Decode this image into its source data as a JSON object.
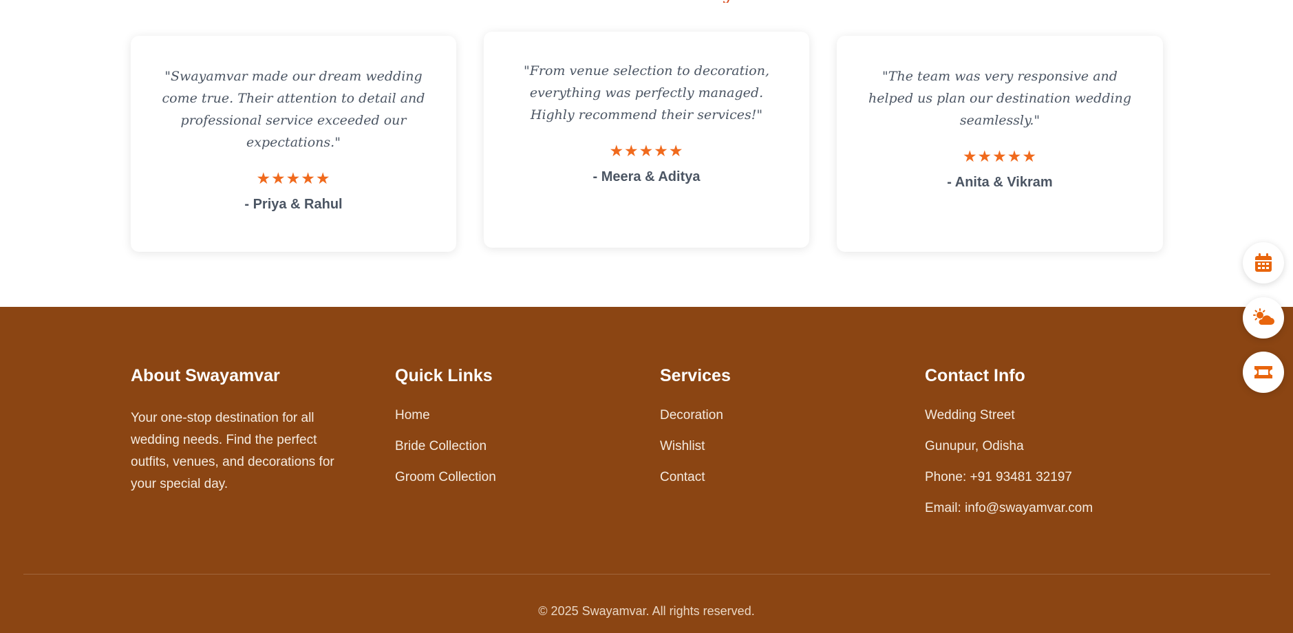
{
  "testimonials": {
    "items": [
      {
        "quote": "\"Swayamvar made our dream wedding come true. Their attention to detail and professional service exceeded our expectations.\"",
        "rating": "★★★★★",
        "author": "- Priya & Rahul"
      },
      {
        "quote": "\"From venue selection to decoration, everything was perfectly managed. Highly recommend their services!\"",
        "rating": "★★★★★",
        "author": "- Meera & Aditya"
      },
      {
        "quote": "\"The team was very responsive and helped us plan our destination wedding seamlessly.\"",
        "rating": "★★★★★",
        "author": "- Anita & Vikram"
      }
    ]
  },
  "footer": {
    "about": {
      "heading": "About Swayamvar",
      "text": "Your one-stop destination for all wedding needs. Find the perfect outfits, venues, and decorations for your special day."
    },
    "quick_links": {
      "heading": "Quick Links",
      "items": [
        "Home",
        "Bride Collection",
        "Groom Collection"
      ]
    },
    "services": {
      "heading": "Services",
      "items": [
        "Decoration",
        "Wishlist",
        "Contact"
      ]
    },
    "contact": {
      "heading": "Contact Info",
      "items": [
        "Wedding Street",
        "Gunupur, Odisha",
        "Phone: +91 93481 32197",
        "Email: info@swayamvar.com"
      ]
    },
    "copyright": "© 2025 Swayamvar. All rights reserved."
  },
  "floating_actions": [
    {
      "icon": "calendar-icon"
    },
    {
      "icon": "weather-icon"
    },
    {
      "icon": "ticket-icon"
    }
  ],
  "colors": {
    "footer_bg": "#8b4513",
    "accent": "#f06a1d",
    "icon": "#e8650d"
  }
}
